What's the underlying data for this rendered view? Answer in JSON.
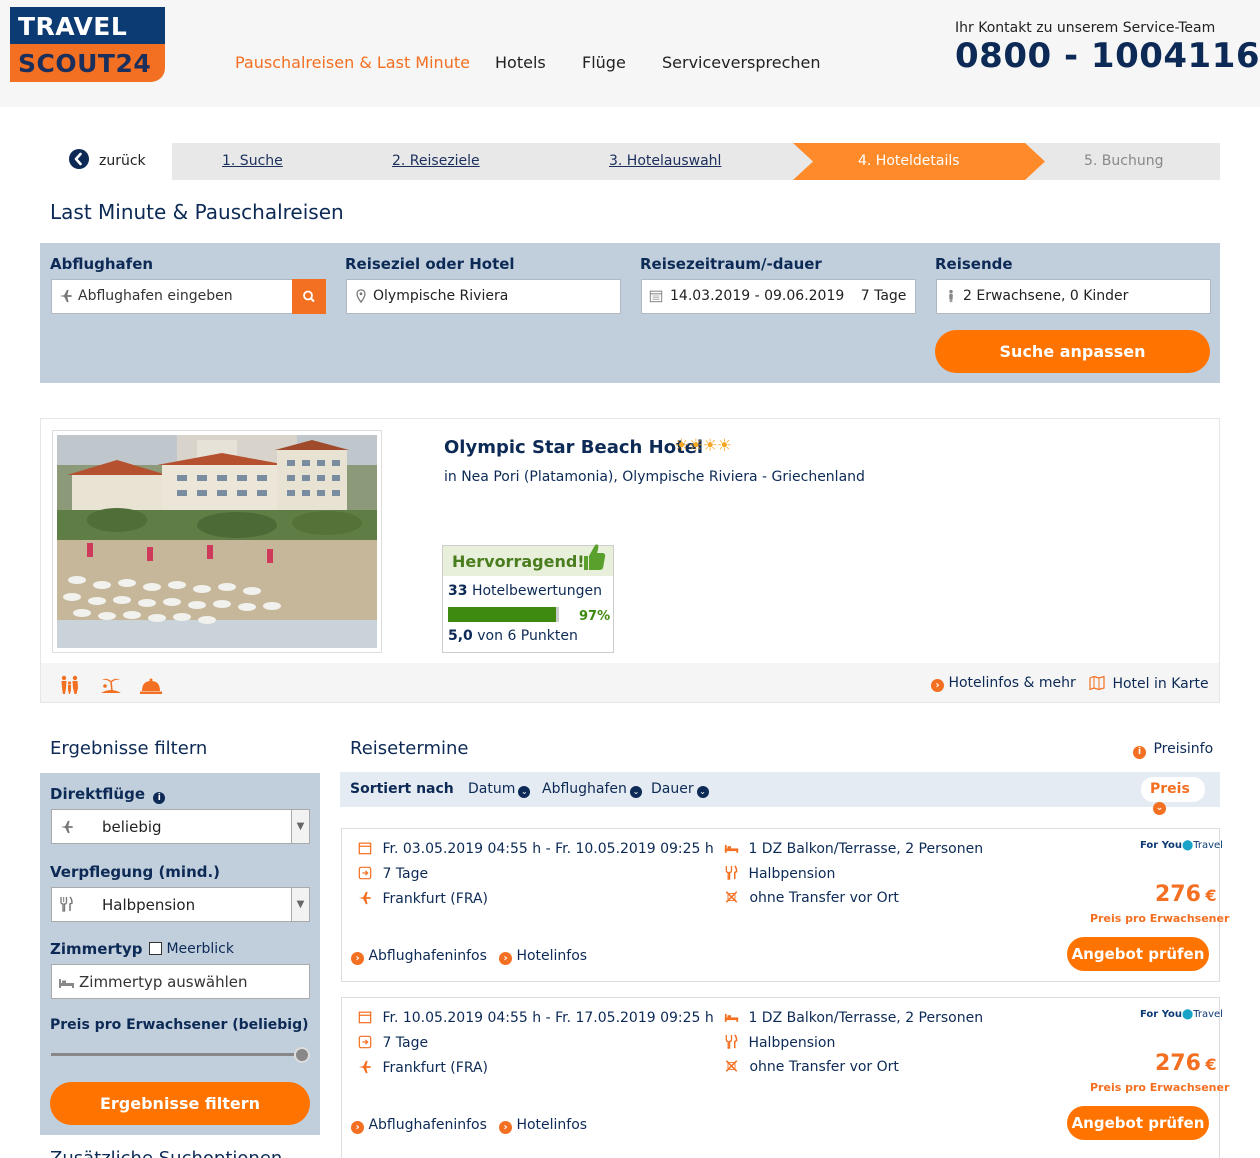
{
  "logo": {
    "line1": "TRAVEL",
    "line2": "SCOUT24"
  },
  "nav": {
    "items": [
      "Pauschalreisen & Last Minute",
      "Hotels",
      "Flüge",
      "Serviceversprechen"
    ]
  },
  "contact": {
    "label": "Ihr Kontakt zu unserem Service-Team",
    "phone": "0800 - 1004116"
  },
  "steps": {
    "back": "zurück",
    "items": [
      "1. Suche",
      "2. Reiseziele",
      "3. Hotelauswahl",
      "4. Hoteldetails",
      "5. Buchung"
    ]
  },
  "page_title": "Last Minute & Pauschalreisen",
  "search": {
    "airport_label": "Abflughafen",
    "airport_placeholder": "Abflughafen eingeben",
    "destination_label": "Reiseziel oder Hotel",
    "destination_value": "Olympische Riviera",
    "period_label": "Reisezeitraum/-dauer",
    "period_value": "14.03.2019 - 09.06.2019",
    "duration_value": "7 Tage",
    "travelers_label": "Reisende",
    "travelers_value": "2 Erwachsene, 0 Kinder",
    "adjust_button": "Suche anpassen"
  },
  "hotel": {
    "name": "Olympic Star Beach Hotel",
    "stars": 4,
    "location": "in Nea Pori (Platamonia), Olympische Riviera - Griechenland",
    "rating_title": "Hervorragend!",
    "review_count": "33",
    "review_label": "Hotelbewertungen",
    "rating_percent": 97,
    "rating_percent_label": "97%",
    "points_value": "5,0",
    "points_label": "von 6 Punkten",
    "info_link": "Hotelinfos & mehr",
    "map_link": "Hotel in Karte"
  },
  "filters": {
    "title": "Ergebnisse filtern",
    "direct_label": "Direktflüge",
    "direct_value": "beliebig",
    "board_label": "Verpflegung (mind.)",
    "board_value": "Halbpension",
    "room_label": "Zimmertyp",
    "seaview_label": "Meerblick",
    "room_placeholder": "Zimmertyp auswählen",
    "price_label": "Preis pro Erwachsener (beliebig)",
    "price_slider_fraction": 1.0,
    "button": "Ergebnisse filtern",
    "extra_title": "Zusätzliche Suchoptionen"
  },
  "results": {
    "title": "Reisetermine",
    "price_info": "Preisinfo",
    "sort_label": "Sortiert nach",
    "sort_date": "Datum",
    "sort_airport": "Abflughafen",
    "sort_duration": "Dauer",
    "sort_price": "Preis",
    "offers": [
      {
        "dates": "Fr. 03.05.2019 04:55 h - Fr. 10.05.2019 09:25 h",
        "duration": "7 Tage",
        "airport": "Frankfurt (FRA)",
        "room": "1 DZ Balkon/Terrasse, 2 Personen",
        "board": "Halbpension",
        "transfer": "ohne Transfer vor Ort",
        "operator_a": "For You",
        "operator_b": "Travel",
        "price": "276",
        "currency": "€",
        "price_sub": "Preis pro Erwachsener",
        "airport_info": "Abflughafeninfos",
        "hotel_info": "Hotelinfos",
        "button": "Angebot prüfen"
      },
      {
        "dates": "Fr. 10.05.2019 04:55 h - Fr. 17.05.2019 09:25 h",
        "duration": "7 Tage",
        "airport": "Frankfurt (FRA)",
        "room": "1 DZ Balkon/Terrasse, 2 Personen",
        "board": "Halbpension",
        "transfer": "ohne Transfer vor Ort",
        "operator_a": "For You",
        "operator_b": "Travel",
        "price": "276",
        "currency": "€",
        "price_sub": "Preis pro Erwachsener",
        "airport_info": "Abflughafeninfos",
        "hotel_info": "Hotelinfos",
        "button": "Angebot prüfen"
      }
    ]
  },
  "colors": {
    "brand_orange": "#f36f21",
    "brand_navy": "#0c2a55",
    "rating_green": "#3e8a10"
  }
}
